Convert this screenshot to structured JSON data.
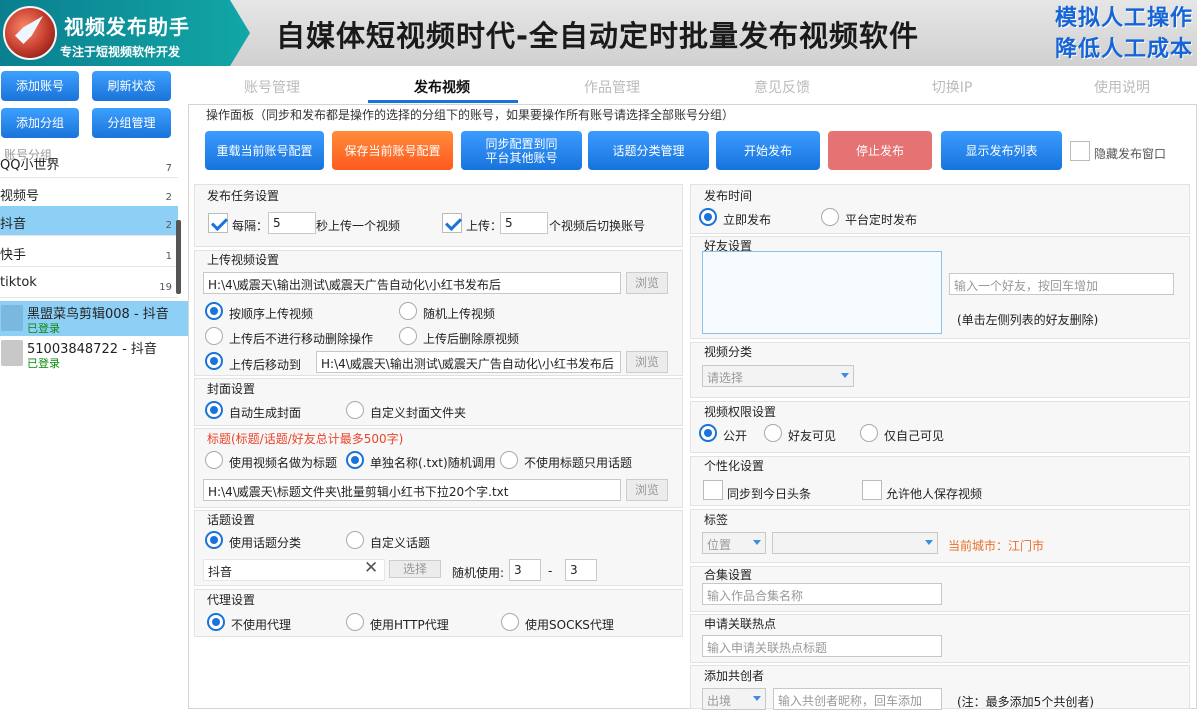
{
  "header": {
    "app_title": "视频发布助手",
    "app_subtitle": "专注于短视频软件开发",
    "slogan": "自媒体短视频时代-全自动定时批量发布视频软件",
    "tag1": "模拟人工操作",
    "tag2": "降低人工成本"
  },
  "sidebar": {
    "buttons": [
      "添加账号",
      "刷新状态",
      "添加分组",
      "分组管理"
    ],
    "group_header": "账号分组",
    "groups": [
      {
        "name": "QQ小世界",
        "count": "7"
      },
      {
        "name": "视频号",
        "count": "2"
      },
      {
        "name": "抖音",
        "count": "2"
      },
      {
        "name": "快手",
        "count": "1"
      },
      {
        "name": "tiktok",
        "count": "19"
      }
    ],
    "accounts": [
      {
        "name": "黑盟菜鸟剪辑008 - 抖音",
        "status": "已登录"
      },
      {
        "name": "51003848722 - 抖音",
        "status": "已登录"
      }
    ]
  },
  "tabs": [
    "账号管理",
    "发布视频",
    "作品管理",
    "意见反馈",
    "切换IP",
    "使用说明"
  ],
  "ops": {
    "header": "操作面板（同步和发布都是操作的选择的分组下的账号，如果要操作所有账号请选择全部账号分组）",
    "buttons": [
      "重载当前账号配置",
      "保存当前账号配置",
      "同步配置到同\n平台其他账号",
      "话题分类管理",
      "开始发布",
      "停止发布",
      "显示发布列表"
    ],
    "hide_label": "隐藏发布窗口"
  },
  "task": {
    "title": "发布任务设置",
    "every": "每隔：",
    "every_val": "5",
    "every_suffix": "秒上传一个视频",
    "upload": "上传：",
    "upload_val": "5",
    "upload_suffix": "个视频后切换账号"
  },
  "upload": {
    "title": "上传视频设置",
    "path": "H:\\4\\威震天\\输出测试\\威震天广告自动化\\小红书发布后",
    "browse": "浏览",
    "opt_seq": "按顺序上传视频",
    "opt_rand": "随机上传视频",
    "opt_nomove": "上传后不进行移动删除操作",
    "opt_delete": "上传后删除原视频",
    "opt_move": "上传后移动到",
    "move_path": "H:\\4\\威震天\\输出测试\\威震天广告自动化\\小红书发布后"
  },
  "cover": {
    "title": "封面设置",
    "auto": "自动生成封面",
    "custom": "自定义封面文件夹"
  },
  "titles": {
    "title": "标题(标题/话题/好友总计最多500字)",
    "opt_name": "使用视频名做为标题",
    "opt_txt": "单独名称(.txt)随机调用",
    "opt_none": "不使用标题只用话题",
    "path": "H:\\4\\威震天\\标题文件夹\\批量剪辑小红书下拉20个字.txt"
  },
  "topic": {
    "title": "话题设置",
    "opt_cat": "使用话题分类",
    "opt_custom": "自定义话题",
    "value": "抖音",
    "choose": "选择",
    "random_label": "随机使用:",
    "min": "3",
    "dash": "-",
    "max": "3"
  },
  "proxy": {
    "title": "代理设置",
    "none": "不使用代理",
    "http": "使用HTTP代理",
    "socks": "使用SOCKS代理"
  },
  "publish_time": {
    "title": "发布时间",
    "now": "立即发布",
    "timed": "平台定时发布"
  },
  "friends": {
    "title": "好友设置",
    "placeholder": "输入一个好友，按回车增加",
    "hint": "(单击左侧列表的好友删除)"
  },
  "category": {
    "title": "视频分类",
    "placeholder": "请选择"
  },
  "permission": {
    "title": "视频权限设置",
    "public": "公开",
    "friends": "好友可见",
    "private": "仅自己可见"
  },
  "personal": {
    "title": "个性化设置",
    "sync": "同步到今日头条",
    "save": "允许他人保存视频"
  },
  "tag": {
    "title": "标签",
    "location": "位置",
    "city": "当前城市：江门市"
  },
  "collection": {
    "title": "合集设置",
    "placeholder": "输入作品合集名称"
  },
  "hotspot": {
    "title": "申请关联热点",
    "placeholder": "输入申请关联热点标题"
  },
  "cocreator": {
    "title": "添加共创者",
    "role": "出境",
    "placeholder": "输入共创者昵称，回车添加",
    "note": "(注：最多添加5个共创者)"
  }
}
